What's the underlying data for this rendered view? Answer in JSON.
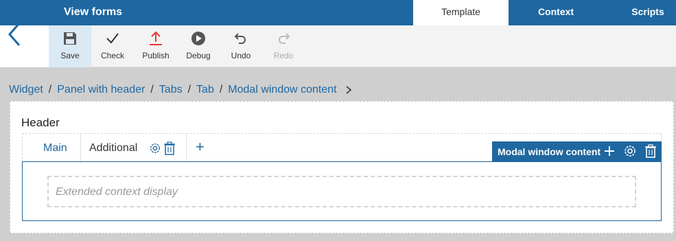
{
  "header": {
    "title": "View forms",
    "tabs": [
      {
        "label": "Template",
        "active": true
      },
      {
        "label": "Context",
        "active": false
      },
      {
        "label": "Scripts",
        "active": false
      }
    ]
  },
  "toolbar": {
    "save": "Save",
    "check": "Check",
    "publish": "Publish",
    "debug": "Debug",
    "undo": "Undo",
    "redo": "Redo"
  },
  "breadcrumb": {
    "items": [
      "Widget",
      "Panel with header",
      "Tabs",
      "Tab",
      "Modal window content"
    ],
    "separator": "/"
  },
  "panel": {
    "header": "Header",
    "tabs": [
      {
        "label": "Main"
      },
      {
        "label": "Additional"
      }
    ],
    "add_tab": "+",
    "placeholder": "Extended context display",
    "selected_widget": "Modal window content"
  },
  "colors": {
    "brand": "#1f67a0",
    "publish_icon": "#e53935",
    "selected_tool_bg": "#dbe9f4"
  }
}
